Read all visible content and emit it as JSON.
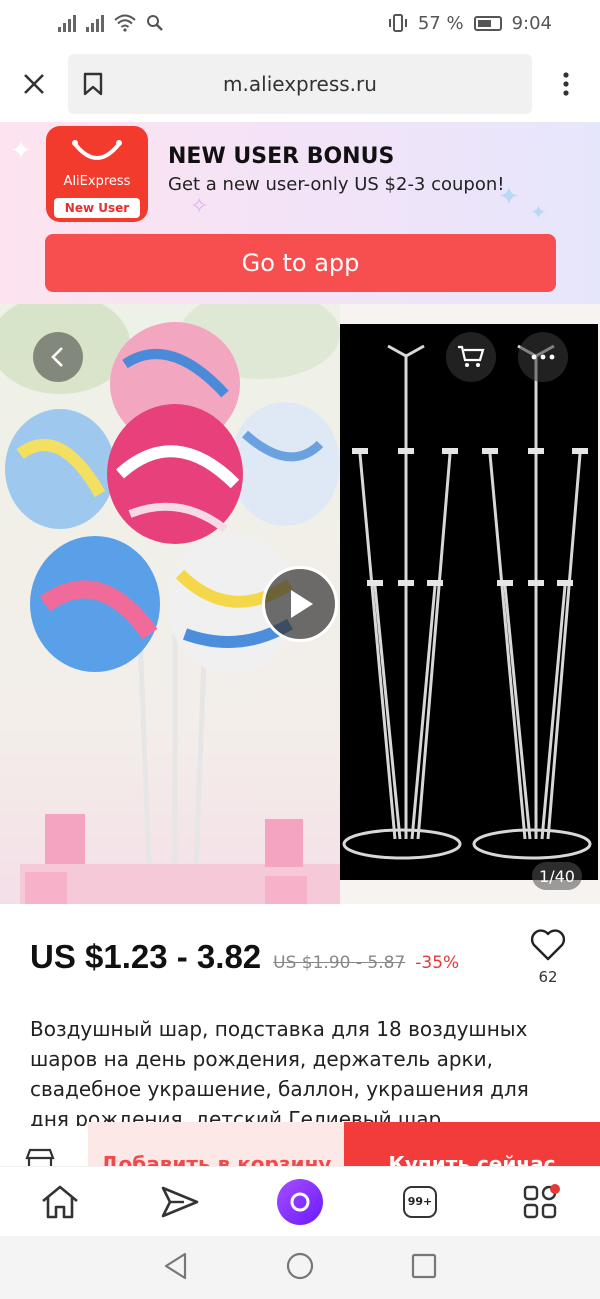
{
  "status_bar": {
    "battery": "57 %",
    "time": "9:04"
  },
  "browser": {
    "url": "m.aliexpress.ru"
  },
  "promo": {
    "logo_brand": "AliExpress",
    "logo_badge": "New User",
    "title": "NEW USER BONUS",
    "subtitle": "Get a new user-only US $2-3 coupon!",
    "button": "Go to app",
    "accent": "#f74f4f"
  },
  "gallery": {
    "counter": "1/40"
  },
  "product": {
    "price": "US $1.23 - 3.82",
    "old_price": "US $1.90 - 5.87",
    "discount": "-35%",
    "wishlist_count": "62",
    "title": "Воздушный шар, подставка для 18 воздушных шаров на день рождения, держатель арки, свадебное украшение, баллон, украшения для дня рождения, детский Гелиевый шар"
  },
  "buy_bar": {
    "add_to_cart": "Добавить в корзину",
    "buy_now": "Купить сейчас"
  },
  "bottom_nav": {
    "cart_badge": "99+",
    "items": [
      "home-icon",
      "send-icon",
      "alice-assistant-icon",
      "messages-icon",
      "categories-icon"
    ]
  }
}
